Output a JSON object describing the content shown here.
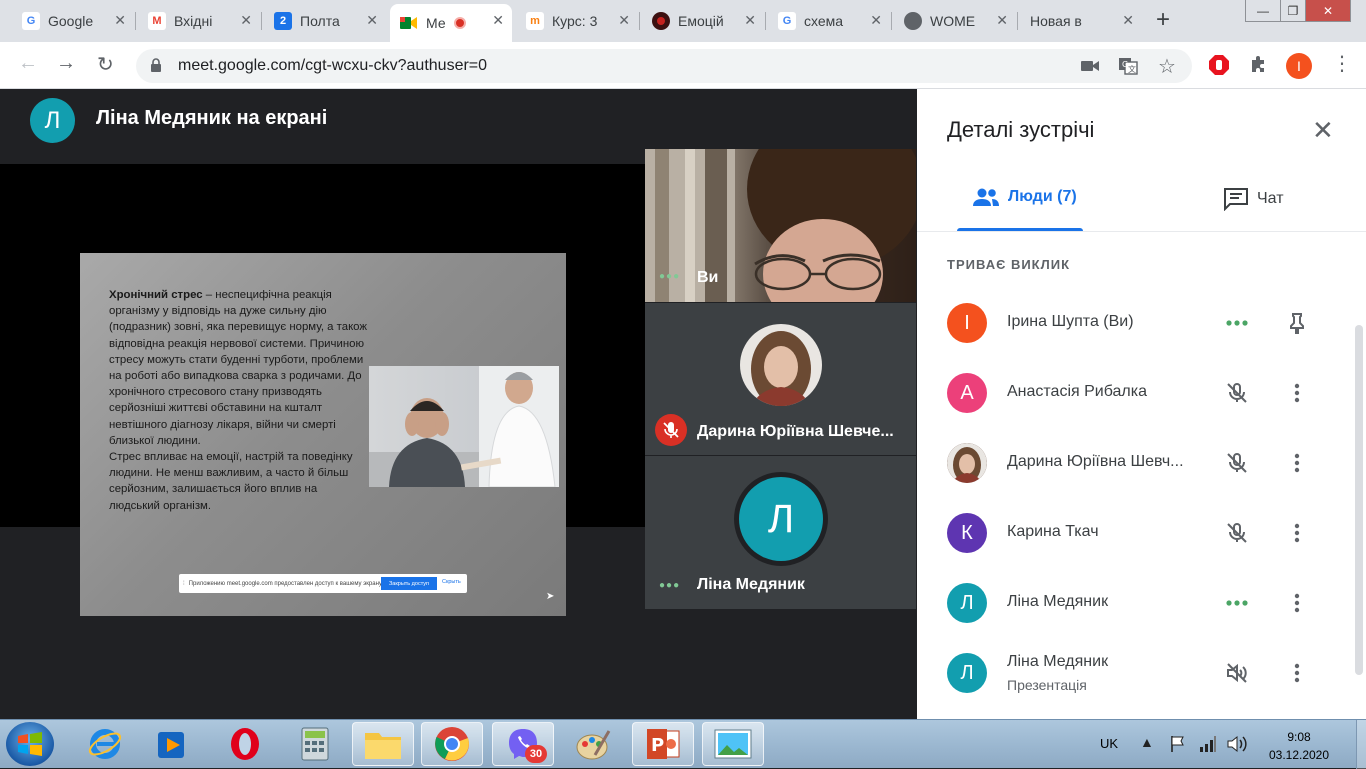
{
  "browser": {
    "tabs": [
      {
        "label": "Google",
        "favicon": "google-icon",
        "color": "#4285f4"
      },
      {
        "label": "Вхідні",
        "favicon": "gmail-icon",
        "color": "#ea4335"
      },
      {
        "label": "Полта",
        "favicon": "calendar-icon",
        "color": "#1a73e8",
        "favicon_text": "2"
      },
      {
        "label": "Ме",
        "favicon": "meet-icon",
        "color": "#00832d",
        "active": true
      },
      {
        "label": "Курс: 3",
        "favicon": "moodle-icon",
        "color": "#f98012"
      },
      {
        "label": "Емоцій",
        "favicon": "record-icon",
        "color": "#c5221f"
      },
      {
        "label": "схема",
        "favicon": "google-icon",
        "color": "#4285f4"
      },
      {
        "label": "WOME",
        "favicon": "globe-icon",
        "color": "#5f6368"
      },
      {
        "label": "Новая вкла",
        "favicon": "",
        "color": "#5f6368"
      }
    ],
    "url": "meet.google.com/cgt-wcxu-ckv?authuser=0",
    "profile_initial": "I",
    "profile_color": "#f4511e"
  },
  "main": {
    "presenter_initial": "Л",
    "presenter_title": "Ліна Медяник на екрані",
    "slide": {
      "heading": "Хронічний стрес",
      "text": " – неспецифічна реакція організму у відповідь на дуже сильну дію (подразник) зовні, яка перевищує норму, а також відповідна реакція нервової системи. Причиною стресу можуть стати буденні турботи, проблеми на роботі або випадкова сварка з родичами. До хронічного стресового стану призводять серйозніші життєві обставини на кшталт невтішного діагнозу лікаря, війни чи смерті близької людини.",
      "text2": "Стрес впливає на емоції, настрій та поведінку людини. Не менш важливим, а часто й більш серйозним, залишається його вплив на людський організм.",
      "share_notice": "Приложению meet.google.com предоставлен доступ к вашему экрану.",
      "share_stop": "Закрыть доступ",
      "share_hide": "Скрыть"
    },
    "tiles": {
      "self_name": "Ви",
      "darina_name": "Дарина Юріївна Шевче...",
      "lina_initial": "Л",
      "lina_name": "Ліна Медяник"
    }
  },
  "sidebar": {
    "title": "Деталі зустрічі",
    "tab_people": "Люди (7)",
    "tab_chat": "Чат",
    "section": "ТРИВАЄ ВИКЛИК",
    "participants": [
      {
        "initial": "I",
        "color": "#f4511e",
        "name": "Ірина Шупта (Ви)",
        "icon1": "speaking-dots-icon",
        "icon2": "pin-icon"
      },
      {
        "initial": "А",
        "color": "#ec407a",
        "name": "Анастасія Рибалка",
        "icon1": "mic-off-icon",
        "icon2": "more-vert-icon"
      },
      {
        "initial": "",
        "color": "#6d4c41",
        "name": "Дарина Юріївна Шевч...",
        "icon1": "mic-off-icon",
        "icon2": "more-vert-icon",
        "photo": true
      },
      {
        "initial": "К",
        "color": "#5e35b1",
        "name": "Карина Ткач",
        "icon1": "mic-off-icon",
        "icon2": "more-vert-icon"
      },
      {
        "initial": "Л",
        "color": "#129eaf",
        "name": "Ліна Медяник",
        "icon1": "speaking-dots-icon",
        "icon2": "more-vert-icon"
      },
      {
        "initial": "Л",
        "color": "#129eaf",
        "name": "Ліна Медяник",
        "sub": "Презентація",
        "icon1": "volume-off-icon",
        "icon2": "more-vert-icon"
      }
    ]
  },
  "taskbar": {
    "viber_badge": "30",
    "lang": "UK",
    "time": "9:08",
    "date": "03.12.2020"
  }
}
